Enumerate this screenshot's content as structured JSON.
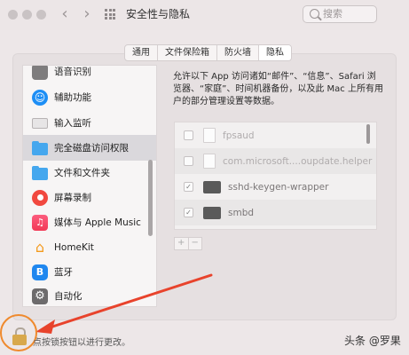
{
  "window": {
    "title": "安全性与隐私",
    "search_placeholder": "搜索"
  },
  "tabs": [
    {
      "label": "通用",
      "active": false
    },
    {
      "label": "文件保险箱",
      "active": false
    },
    {
      "label": "防火墙",
      "active": false
    },
    {
      "label": "隐私",
      "active": true
    }
  ],
  "sidebar": {
    "items": [
      {
        "label": "语音识别",
        "icon": "speech-recognition-icon"
      },
      {
        "label": "辅助功能",
        "icon": "accessibility-icon"
      },
      {
        "label": "输入监听",
        "icon": "keyboard-icon"
      },
      {
        "label": "完全磁盘访问权限",
        "icon": "folder-icon",
        "selected": true
      },
      {
        "label": "文件和文件夹",
        "icon": "folder-icon"
      },
      {
        "label": "屏幕录制",
        "icon": "screen-record-icon"
      },
      {
        "label": "媒体与 Apple Music",
        "icon": "music-icon"
      },
      {
        "label": "HomeKit",
        "icon": "home-icon"
      },
      {
        "label": "蓝牙",
        "icon": "bluetooth-icon"
      },
      {
        "label": "自动化",
        "icon": "gear-icon"
      }
    ]
  },
  "main": {
    "description": "允许以下 App 访问诸如“邮件”、“信息”、Safari 浏览器、“家庭”、时间机器备份，以及此 Mac 上所有用户的部分管理设置等数据。",
    "apps": [
      {
        "name": "fpsaud",
        "checked": false
      },
      {
        "name": "com.microsoft....oupdate.helper",
        "checked": false
      },
      {
        "name": "sshd-keygen-wrapper",
        "checked": true
      },
      {
        "name": "smbd",
        "checked": true
      }
    ],
    "add_label": "+",
    "remove_label": "−"
  },
  "footer": {
    "lock_text": "点按锁按钮以进行更改。",
    "watermark": "头条 @罗果"
  },
  "colors": {
    "highlight_circle": "#ef8a2e",
    "arrow": "#e8432c",
    "selected_row": "#dad8dc"
  }
}
